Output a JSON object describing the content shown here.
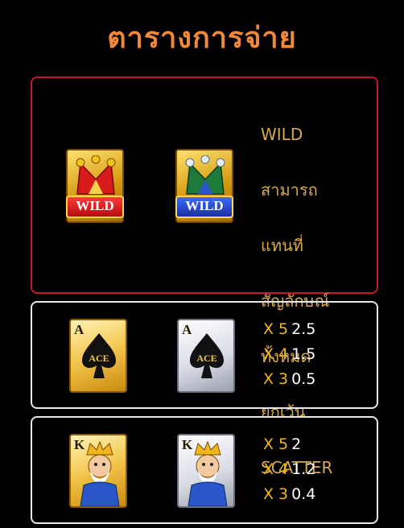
{
  "title": "ตารางการจ่าย",
  "wild_panel": {
    "symbol_labels": [
      "WILD",
      "WILD"
    ],
    "description_lines": [
      "WILD",
      "สามารถ",
      "แทนที่",
      "สัญลักษณ์",
      "ทั้งหมด",
      "ยกเว้น",
      "SCATTER"
    ]
  },
  "ace_panel": {
    "rank": "A",
    "card_label": "ACE",
    "pays": [
      {
        "mult": "X 5",
        "value": "2.5"
      },
      {
        "mult": "X 4",
        "value": "1.5"
      },
      {
        "mult": "X 3",
        "value": "0.5"
      }
    ]
  },
  "king_panel": {
    "rank": "K",
    "pays": [
      {
        "mult": "X 5",
        "value": "2"
      },
      {
        "mult": "X 4",
        "value": "1.2"
      },
      {
        "mult": "X 3",
        "value": "0.4"
      }
    ]
  },
  "colors": {
    "title": "#f08a3a",
    "wild_border": "#c0182a",
    "panel_border": "#e8e8e8",
    "description_text": "#d7a84f",
    "multiplier_text": "#f2b61d"
  },
  "icons": [
    "wild-jester-red-icon",
    "wild-jester-blue-icon",
    "ace-spade-gold-icon",
    "ace-spade-silver-icon",
    "king-card-gold-icon",
    "king-card-silver-icon"
  ]
}
